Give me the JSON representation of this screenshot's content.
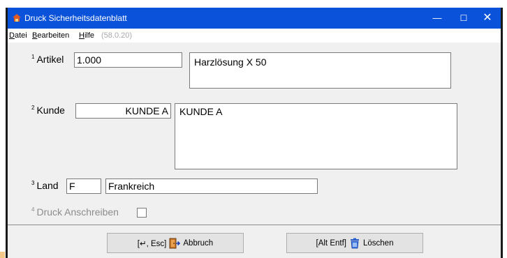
{
  "window": {
    "title": "Druck Sicherheitsdatenblatt",
    "controls": {
      "minimize": "—",
      "maximize": "☐",
      "close": "✕"
    }
  },
  "menu": {
    "items": [
      {
        "label": "Datei",
        "mnemonic": "D",
        "rest": "atei"
      },
      {
        "label": "Bearbeiten",
        "mnemonic": "B",
        "rest": "earbeiten"
      },
      {
        "label": "Hilfe",
        "mnemonic": "H",
        "rest": "ilfe"
      }
    ],
    "version": "(58.0.20)"
  },
  "form": {
    "artikel": {
      "number": "1",
      "label": "Artikel",
      "code": "1.000",
      "description": "Harzlösung X 50"
    },
    "kunde": {
      "number": "2",
      "label": "Kunde",
      "code": "KUNDE A",
      "description": "KUNDE A"
    },
    "land": {
      "number": "3",
      "label": "Land",
      "code": "F",
      "name": "Frankreich"
    },
    "druck_anschreiben": {
      "number": "4",
      "label": "Druck Anschreiben",
      "checked": false
    }
  },
  "buttons": {
    "abbruch": {
      "shortcut": "[↵, Esc]",
      "label": "Abbruch",
      "icon": "exit-door-icon"
    },
    "loeschen": {
      "shortcut": "[Alt Entf]",
      "label": "Löschen",
      "icon": "trash-can-icon"
    }
  },
  "colors": {
    "titlebar": "#0a52d9",
    "window_bg": "#f0f0f0",
    "field_border": "#7a7a7a"
  }
}
